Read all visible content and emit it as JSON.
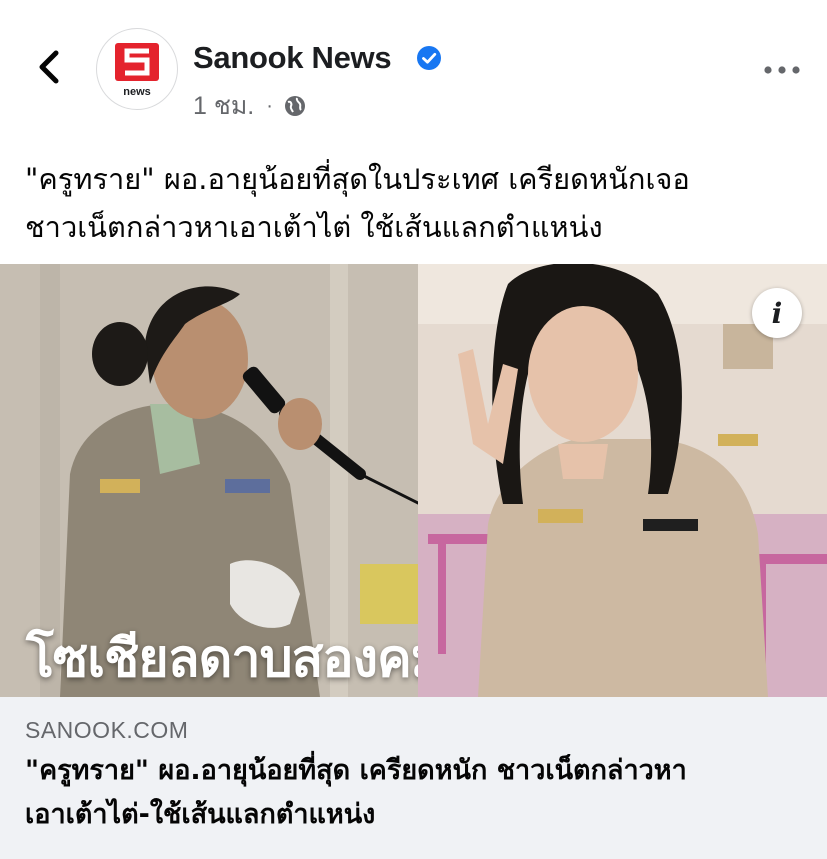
{
  "header": {
    "page_name": "Sanook News",
    "time": "1 ชม.",
    "separator": "·",
    "avatar_brand": "news",
    "verified_color": "#1877f2"
  },
  "post": {
    "text_lines": [
      "\"ครูทราย\" ผอ.อายุน้อยที่สุดในประเทศ เครียดหนักเจอ",
      "ชาวเน็ตกล่าวหาเอาเต้าไต่ ใช้เส้นแลกตำแหน่ง"
    ]
  },
  "media": {
    "overlay_text": "โซเชียลดาบสองคม",
    "info_label": "i"
  },
  "link": {
    "domain": "SANOOK.COM",
    "title_lines": [
      "\"ครูทราย\" ผอ.อายุน้อยที่สุด เครียดหนัก ชาวเน็ตกล่าวหา",
      "เอาเต้าไต่-ใช้เส้นแลกตำแหน่ง"
    ]
  },
  "icons": {
    "back": "chevron-left-icon",
    "more": "more-horizontal-icon",
    "privacy": "globe-icon",
    "verified": "verified-badge-icon",
    "info": "info-icon"
  }
}
